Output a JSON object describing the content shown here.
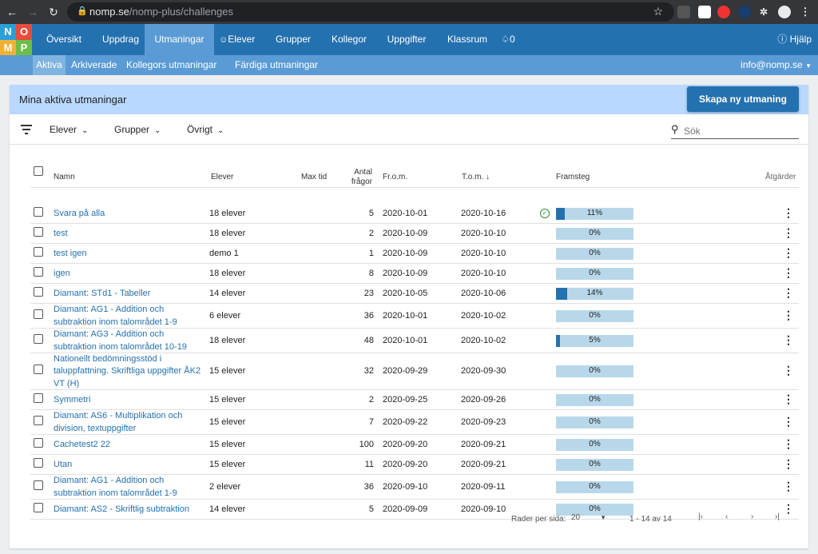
{
  "browser": {
    "domain": "nomp.se",
    "path": "/nomp-plus/challenges"
  },
  "logo": {
    "letters": [
      "N",
      "O",
      "M",
      "P"
    ]
  },
  "nav": {
    "items": [
      "Översikt",
      "Uppdrag",
      "Utmaningar",
      "Elever",
      "Grupper",
      "Kollegor",
      "Uppgifter",
      "Klassrum",
      "0"
    ],
    "help": "Hjälp"
  },
  "subnav": {
    "items": [
      "Aktiva",
      "Arkiverade",
      "Kollegors utmaningar",
      "Färdiga utmaningar"
    ],
    "user": "info@nomp.se"
  },
  "panel": {
    "title": "Mina aktiva utmaningar",
    "create_label": "Skapa ny utmaning"
  },
  "filters": {
    "students": "Elever",
    "groups": "Grupper",
    "other": "Övrigt",
    "search_placeholder": "Sök"
  },
  "columns": {
    "name": "Namn",
    "students": "Elever",
    "max_time": "Max tid",
    "questions_1": "Antal",
    "questions_2": "frågor",
    "from": "Fr.o.m.",
    "to": "T.o.m.",
    "progress": "Framsteg",
    "actions": "Åtgärder"
  },
  "rows": [
    {
      "name": "Svara på alla",
      "students": "18 elever",
      "questions": "5",
      "from": "2020-10-01",
      "to": "2020-10-16",
      "progress": "11%",
      "progress_value": 0.11,
      "done": true
    },
    {
      "name": "test",
      "students": "18 elever",
      "questions": "2",
      "from": "2020-10-09",
      "to": "2020-10-10",
      "progress": "0%",
      "progress_value": 0
    },
    {
      "name": "test igen",
      "students": "demo 1",
      "questions": "1",
      "from": "2020-10-09",
      "to": "2020-10-10",
      "progress": "0%",
      "progress_value": 0
    },
    {
      "name": "igen",
      "students": "18 elever",
      "questions": "8",
      "from": "2020-10-09",
      "to": "2020-10-10",
      "progress": "0%",
      "progress_value": 0
    },
    {
      "name": "Diamant: STd1 - Tabeller",
      "students": "14 elever",
      "questions": "23",
      "from": "2020-10-05",
      "to": "2020-10-06",
      "progress": "14%",
      "progress_value": 0.14
    },
    {
      "name": "Diamant: AG1 - Addition och subtraktion inom talområdet 1-9",
      "students": "6 elever",
      "questions": "36",
      "from": "2020-10-01",
      "to": "2020-10-02",
      "progress": "0%",
      "progress_value": 0
    },
    {
      "name": "Diamant: AG3 - Addition och subtraktion inom talområdet 10-19",
      "students": "18 elever",
      "questions": "48",
      "from": "2020-10-01",
      "to": "2020-10-02",
      "progress": "5%",
      "progress_value": 0.05
    },
    {
      "name": "Nationellt bedömningsstöd i taluppfattning. Skriftliga uppgifter ÅK2 VT (H)",
      "students": "15 elever",
      "questions": "32",
      "from": "2020-09-29",
      "to": "2020-09-30",
      "progress": "0%",
      "progress_value": 0
    },
    {
      "name": "Symmetri",
      "students": "15 elever",
      "questions": "2",
      "from": "2020-09-25",
      "to": "2020-09-26",
      "progress": "0%",
      "progress_value": 0
    },
    {
      "name": "Diamant: AS6 - Multiplikation och division, textuppgifter",
      "students": "15 elever",
      "questions": "7",
      "from": "2020-09-22",
      "to": "2020-09-23",
      "progress": "0%",
      "progress_value": 0
    },
    {
      "name": "Cachetest2 22",
      "students": "15 elever",
      "questions": "100",
      "from": "2020-09-20",
      "to": "2020-09-21",
      "progress": "0%",
      "progress_value": 0
    },
    {
      "name": "Utan",
      "students": "15 elever",
      "questions": "11",
      "from": "2020-09-20",
      "to": "2020-09-21",
      "progress": "0%",
      "progress_value": 0
    },
    {
      "name": "Diamant: AG1 - Addition och subtraktion inom talområdet 1-9",
      "students": "2 elever",
      "questions": "36",
      "from": "2020-09-10",
      "to": "2020-09-11",
      "progress": "0%",
      "progress_value": 0
    },
    {
      "name": "Diamant: AS2 - Skriftlig subtraktion",
      "students": "14 elever",
      "questions": "5",
      "from": "2020-09-09",
      "to": "2020-09-10",
      "progress": "0%",
      "progress_value": 0
    }
  ],
  "pagination": {
    "rows_label": "Rader per sida:",
    "rows_value": "20",
    "range": "1 - 14 av 14"
  },
  "colors": {
    "primary": "#2471b0",
    "subnav": "#5b9bd5",
    "panel_header": "#b8d8ff",
    "progress_track": "#b8d8ea"
  }
}
